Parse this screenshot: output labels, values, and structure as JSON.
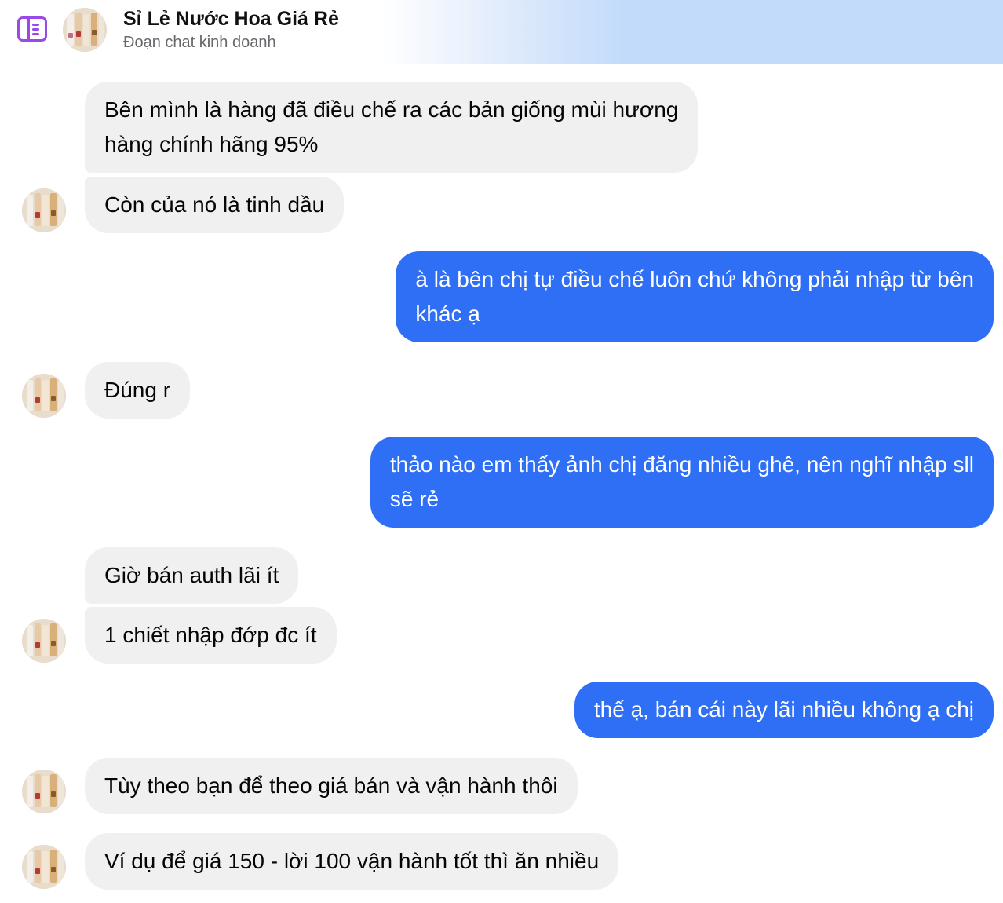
{
  "header": {
    "title": "Sỉ Lẻ Nước Hoa Giá Rẻ",
    "subtitle": "Đoạn chat kinh doanh",
    "toggle_icon": "sidebar-toggle-icon"
  },
  "colors": {
    "incoming_bubble": "#f0f0f0",
    "outgoing_bubble": "#2f6ff6",
    "accent": "#9b4ae8"
  },
  "messages": [
    {
      "from": "them",
      "lines": [
        "Bên mình là hàng đã điều chế ra các bản giống mùi hương",
        "hàng chính hãng 95%"
      ]
    },
    {
      "from": "them",
      "lines": [
        "Còn của nó là tinh dầu"
      ]
    },
    {
      "from": "me",
      "lines": [
        "à là bên chị tự điều chế luôn chứ không phải nhập từ bên",
        "khác ạ"
      ]
    },
    {
      "from": "them",
      "lines": [
        "Đúng r"
      ]
    },
    {
      "from": "me",
      "lines": [
        "thảo nào em thấy ảnh chị đăng nhiều ghê, nên nghĩ nhập sll",
        "sẽ rẻ"
      ]
    },
    {
      "from": "them",
      "lines": [
        "Giờ bán auth lãi ít"
      ]
    },
    {
      "from": "them",
      "lines": [
        "1 chiết nhập đớp đc ít"
      ]
    },
    {
      "from": "me",
      "lines": [
        "thế ạ, bán cái này lãi nhiều không ạ chị"
      ]
    },
    {
      "from": "them",
      "lines": [
        "Tùy theo bạn để theo giá bán và vận hành thôi"
      ]
    },
    {
      "from": "them",
      "lines": [
        "Ví dụ để giá 150 - lời 100 vận hành tốt thì ăn nhiều"
      ]
    }
  ]
}
